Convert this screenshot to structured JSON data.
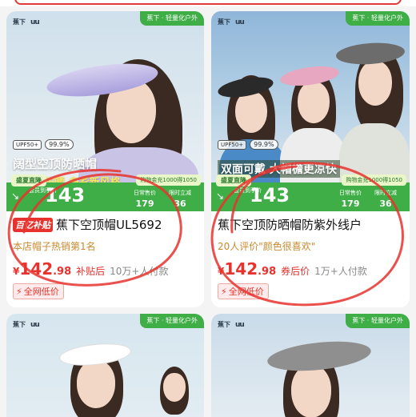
{
  "products": [
    {
      "brand_a": "蕉下",
      "brand_b": "uu",
      "ribbon": "蕉下 · 轻量化户外",
      "mini_tag": "UPF50+",
      "upf": "99.9%",
      "headline_1": "阔型空顶防晒帽",
      "headline_2": "轻盈强防晒 多彩新风格",
      "live_tag": "盛夏直降",
      "price_small": "会员到手价",
      "price_big": "143",
      "compare_tag": "购物金充1000得1050",
      "col_a_label": "日常售价",
      "col_a_value": "179",
      "col_b_label": "限时立减",
      "col_b_value": "36",
      "subsidy_tag": "百亿补贴",
      "title": "蕉下空顶帽UL5692",
      "rank": "本店帽子热销第1名",
      "currency": "¥",
      "price_int": "142",
      "price_dec": ".98",
      "price_note": "补贴后",
      "sold": "10万+人付款",
      "lowest": "全网低价"
    },
    {
      "brand_a": "蕉下",
      "brand_b": "uu",
      "ribbon": "蕉下 · 轻量化户外",
      "mini_tag": "UPF50+",
      "upf": "99.9%",
      "headline_1": "双面可戴 大帽檐更凉快",
      "headline_2": "",
      "live_tag": "盛夏直降",
      "price_small": "会员到手价",
      "price_big": "143",
      "compare_tag": "购物金充1000得1050",
      "col_a_label": "日常售价",
      "col_a_value": "179",
      "col_b_label": "限时立减",
      "col_b_value": "36",
      "subsidy_tag": "",
      "title": "蕉下空顶防晒帽防紫外线户",
      "rank": "20人评价\"颜色很喜欢\"",
      "currency": "¥",
      "price_int": "142",
      "price_dec": ".98",
      "price_note": "券后价",
      "sold": "1万+人付款",
      "lowest": "全网低价"
    },
    {
      "brand_a": "蕉下",
      "brand_b": "uu",
      "ribbon": "蕉下 · 轻量化户外"
    },
    {
      "brand_a": "蕉下",
      "brand_b": "uu",
      "ribbon": "蕉下 · 轻量化户外"
    }
  ],
  "colors": {
    "accent_red": "#e8322d",
    "brand_green": "#3fae46",
    "rank_gold": "#c9892e"
  }
}
